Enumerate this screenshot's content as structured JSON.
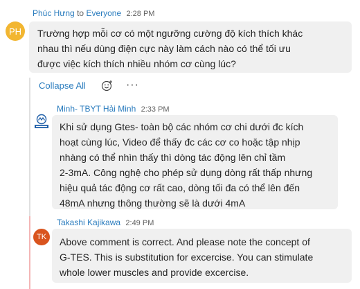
{
  "messages": [
    {
      "sender": "Phúc Hưng",
      "recipient_prefix": "to",
      "recipient": "Everyone",
      "time": "2:28 PM",
      "avatar_initials": "PH",
      "avatar_color": "#f2b631",
      "lines": [
        "Trường hợp mỗi cơ có một ngưỡng cường độ kích thích khác",
        "nhau thì nếu dùng điện cực này làm cách nào có thể tối ưu",
        "được việc kích thích nhiều nhóm cơ cùng lúc?"
      ]
    },
    {
      "sender": "Minh- TBYT Hải Minh",
      "time": "2:33 PM",
      "avatar_icon": "company-logo-icon",
      "lines": [
        "Khi sử dụng Gtes- toàn bộ các nhóm cơ chi dưới đc kích",
        "hoạt cùng lúc, Video để thấy đc các cơ co hoặc tập nhịp",
        "nhàng có thể nhìn thấy thì dòng tác động lên chỉ tầm",
        "2-3mA. Công nghệ cho phép sử dụng dòng rất thấp nhưng",
        "hiệu quả tác động cơ rất cao, dòng tối đa có thể lên đến",
        "48mA nhưng thông thường sẽ là dưới 4mA"
      ]
    },
    {
      "sender": "Takashi Kajikawa",
      "time": "2:49 PM",
      "avatar_initials": "TK",
      "avatar_color": "#d9541e",
      "lines": [
        "Above comment is correct. And please note the concept of",
        "G-TES. This  is substitution for excercise. You can stimulate",
        "whole lower muscles and provide excercise."
      ]
    }
  ],
  "thread": {
    "collapse_label": "Collapse All",
    "react_icon": "smiley-icon",
    "more_icon": "more-options-icon",
    "more_label": "···"
  },
  "colors": {
    "link": "#2a7cbe",
    "bubble": "#f0f0f0",
    "thread_bar": "#e0e0e0",
    "unread_marker": "#f4b6b6"
  }
}
